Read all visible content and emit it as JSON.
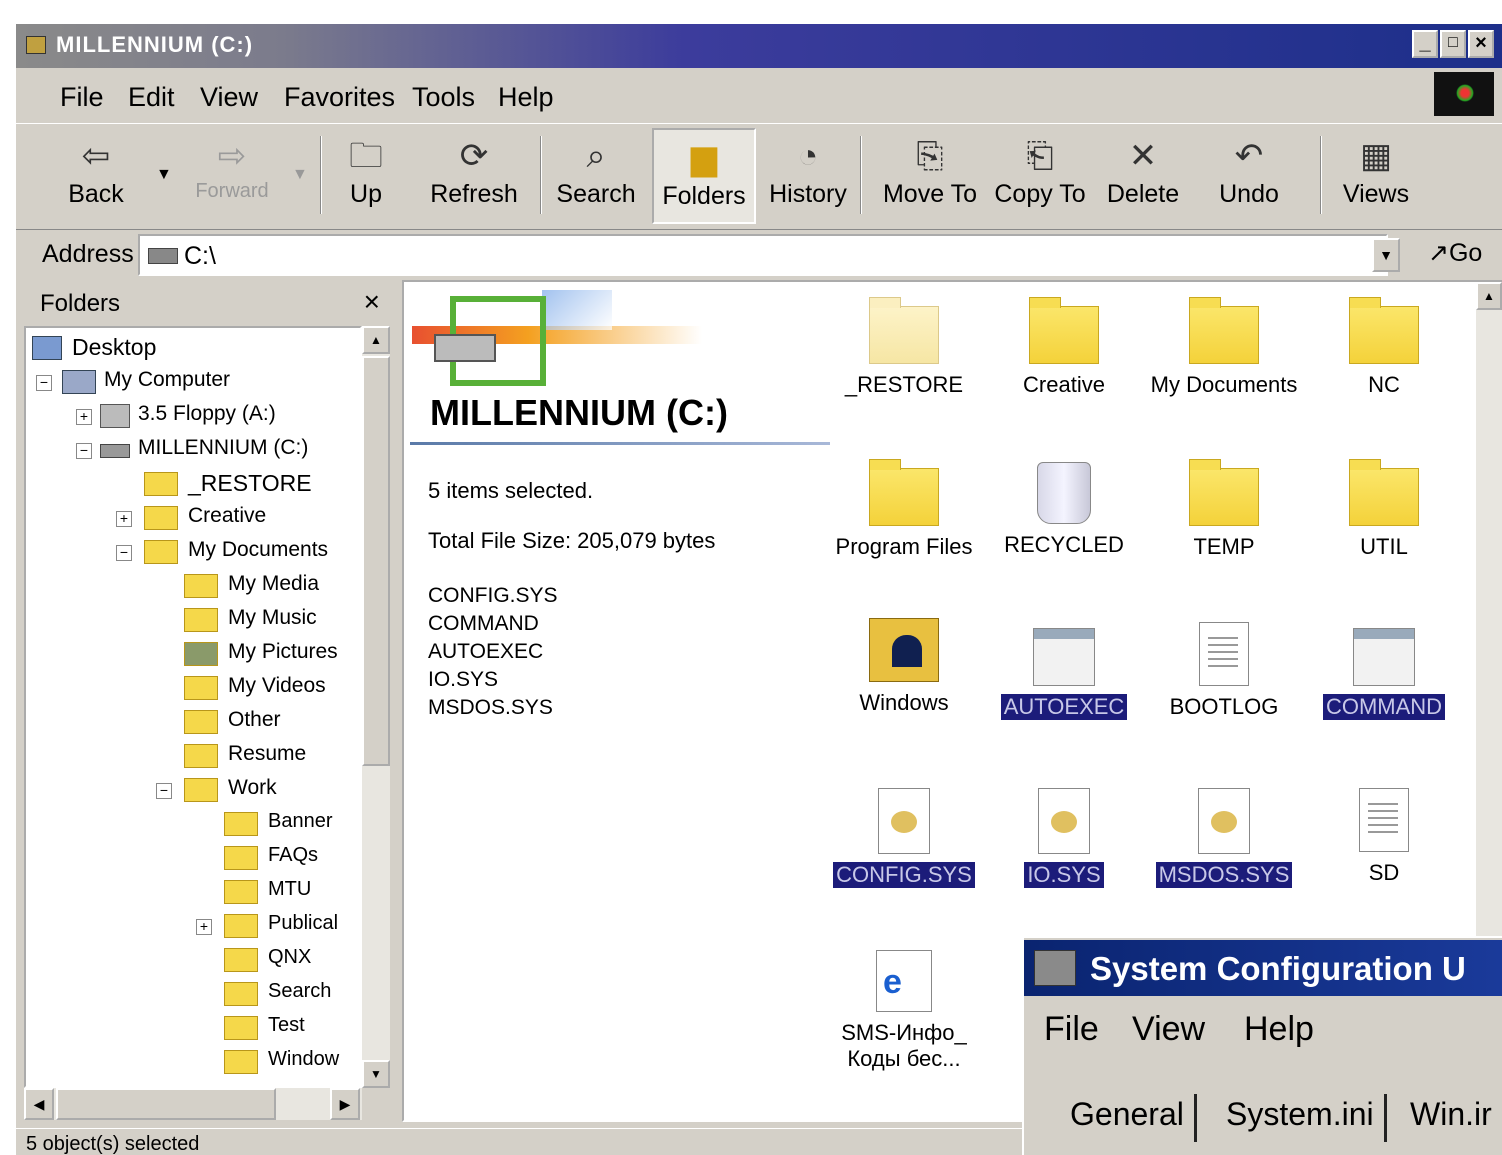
{
  "window": {
    "title": "MILLENNIUM (C:)",
    "controls": [
      "_",
      "□",
      "×"
    ]
  },
  "menu": [
    "File",
    "Edit",
    "View",
    "Favorites",
    "Tools",
    "Help"
  ],
  "toolbar": {
    "back": "Back",
    "forward": "Forward",
    "up": "Up",
    "refresh": "Refresh",
    "search": "Search",
    "folders": "Folders",
    "history": "History",
    "move_to": "Move To",
    "copy_to": "Copy To",
    "delete": "Delete",
    "undo": "Undo",
    "views": "Views"
  },
  "address": {
    "label": "Address",
    "value": "C:\\",
    "go": "Go"
  },
  "folders_pane": {
    "title": "Folders",
    "close": "×",
    "tree": [
      {
        "label": "Desktop"
      },
      {
        "label": "My Computer"
      },
      {
        "label": "3.5 Floppy (A:)"
      },
      {
        "label": "MILLENNIUM (C:)"
      },
      {
        "label": "_RESTORE"
      },
      {
        "label": "Creative"
      },
      {
        "label": "My Documents"
      },
      {
        "label": "My Media"
      },
      {
        "label": "My Music"
      },
      {
        "label": "My Pictures"
      },
      {
        "label": "My Videos"
      },
      {
        "label": "Other"
      },
      {
        "label": "Resume"
      },
      {
        "label": "Work"
      },
      {
        "label": "Banner"
      },
      {
        "label": "FAQs"
      },
      {
        "label": "MTU"
      },
      {
        "label": "Publical"
      },
      {
        "label": "QNX"
      },
      {
        "label": "Search"
      },
      {
        "label": "Test"
      },
      {
        "label": "Window"
      }
    ]
  },
  "content": {
    "drive_title": "MILLENNIUM (C:)",
    "items_selected": "5 items selected.",
    "total_size": "Total File Size: 205,079 bytes",
    "selected_list": [
      "CONFIG.SYS",
      "COMMAND",
      "AUTOEXEC",
      "IO.SYS",
      "MSDOS.SYS"
    ],
    "icons": [
      {
        "label": "_RESTORE",
        "type": "folder-pale",
        "selected": false
      },
      {
        "label": "Creative",
        "type": "folder",
        "selected": false
      },
      {
        "label": "My Documents",
        "type": "folder",
        "selected": false
      },
      {
        "label": "NC",
        "type": "folder",
        "selected": false
      },
      {
        "label": "Program Files",
        "type": "folder",
        "selected": false
      },
      {
        "label": "RECYCLED",
        "type": "recycle-bin",
        "selected": false
      },
      {
        "label": "TEMP",
        "type": "folder",
        "selected": false
      },
      {
        "label": "UTIL",
        "type": "folder",
        "selected": false
      },
      {
        "label": "Windows",
        "type": "windows-folder",
        "selected": false
      },
      {
        "label": "AUTOEXEC",
        "type": "system-file",
        "selected": true
      },
      {
        "label": "BOOTLOG",
        "type": "text-file",
        "selected": false
      },
      {
        "label": "COMMAND",
        "type": "program-file",
        "selected": true
      },
      {
        "label": "CONFIG.SYS",
        "type": "system-file",
        "selected": true
      },
      {
        "label": "IO.SYS",
        "type": "system-file",
        "selected": true
      },
      {
        "label": "MSDOS.SYS",
        "type": "system-file",
        "selected": true
      },
      {
        "label": "SD",
        "type": "settings-file",
        "selected": false
      },
      {
        "label": "SMS-Инфо_ Коды бес...",
        "type": "internet-shortcut",
        "selected": false
      }
    ]
  },
  "status": {
    "text": "5 object(s) selected"
  },
  "msconfig": {
    "title": "System Configuration U",
    "menu": [
      "File",
      "View",
      "Help"
    ],
    "tabs": [
      "General",
      "System.ini",
      "Win.ir"
    ]
  }
}
